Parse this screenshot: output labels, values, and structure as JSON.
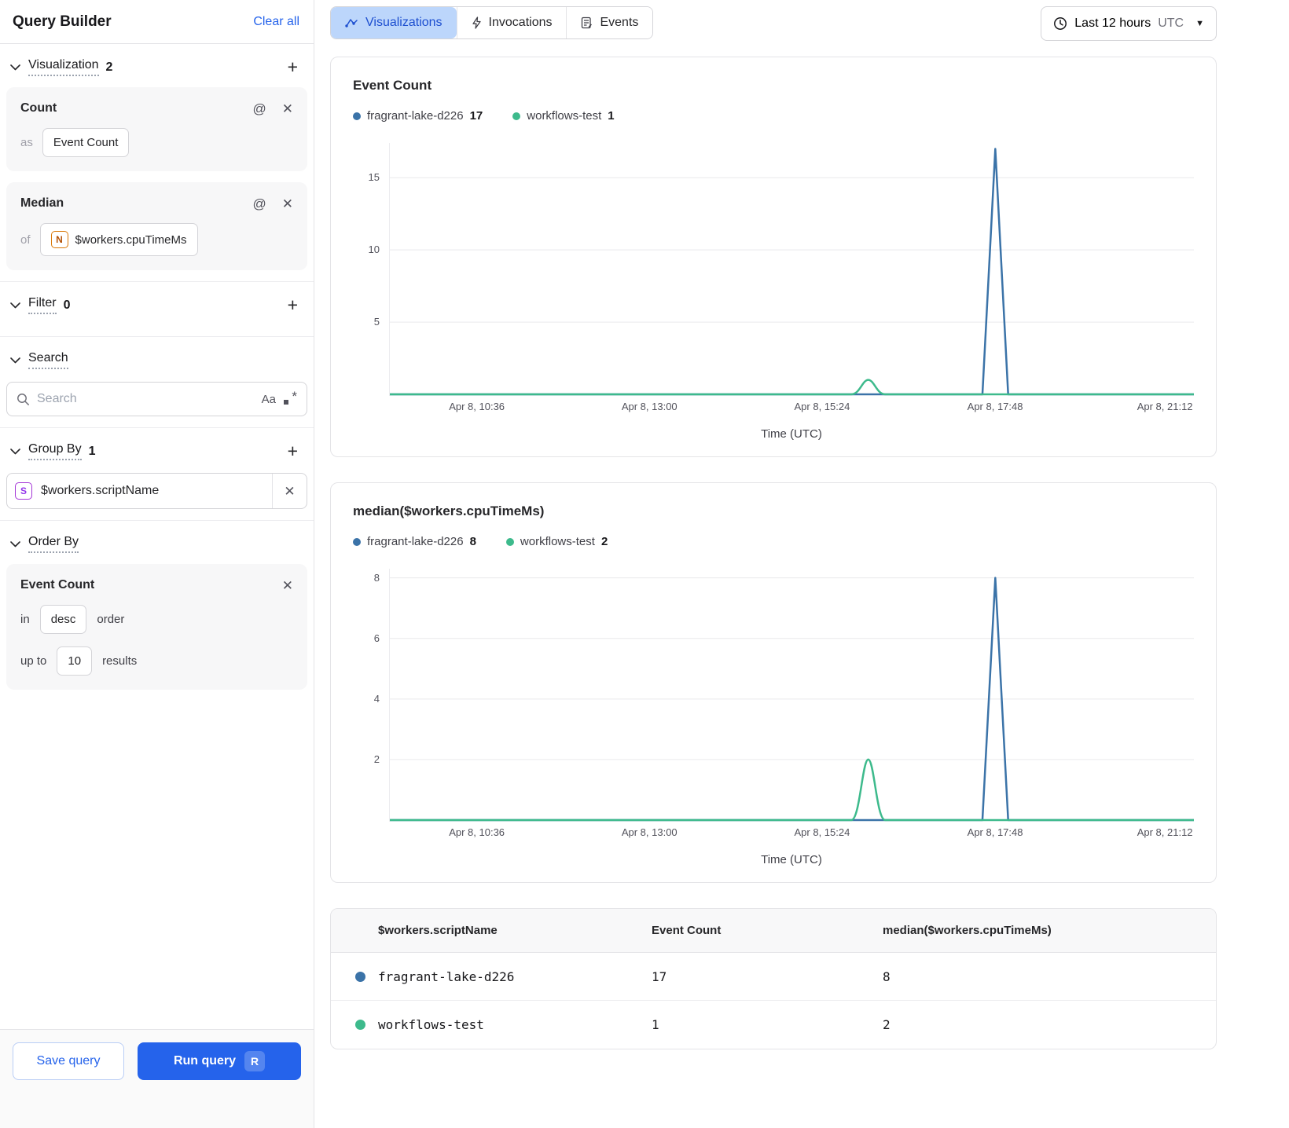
{
  "sidebar": {
    "title": "Query Builder",
    "clear_all": "Clear all",
    "visualization": {
      "label": "Visualization",
      "count": "2",
      "count_card": {
        "title": "Count",
        "prefix": "as",
        "value": "Event Count"
      },
      "median_card": {
        "title": "Median",
        "prefix": "of",
        "field_icon": "N",
        "value": "$workers.cpuTimeMs"
      }
    },
    "filter": {
      "label": "Filter",
      "count": "0"
    },
    "search": {
      "label": "Search",
      "placeholder": "Search",
      "match_case_label": "Aa"
    },
    "group_by": {
      "label": "Group By",
      "count": "1",
      "field_icon": "S",
      "value": "$workers.scriptName"
    },
    "order_by": {
      "label": "Order By",
      "field": "Event Count",
      "in_label": "in",
      "direction": "desc",
      "order_label": "order",
      "up_to_label": "up to",
      "limit": "10",
      "results_label": "results"
    },
    "footer": {
      "save_label": "Save query",
      "run_label": "Run query",
      "run_shortcut": "R"
    }
  },
  "topbar": {
    "tabs": [
      {
        "label": "Visualizations",
        "active": true
      },
      {
        "label": "Invocations",
        "active": false
      },
      {
        "label": "Events",
        "active": false
      }
    ],
    "time_range": {
      "label": "Last 12 hours",
      "timezone": "UTC"
    }
  },
  "colors": {
    "series_blue": "#3b73a8",
    "series_green": "#3dba8c",
    "accent_blue": "#2563eb"
  },
  "chart_data": [
    {
      "type": "line",
      "title": "Event Count",
      "xlabel": "Time (UTC)",
      "ylim": [
        0,
        17.3
      ],
      "y_ticks": [
        5,
        10,
        15
      ],
      "x_ticks": [
        {
          "label": "Apr 8, 10:36",
          "pos": 0.109
        },
        {
          "label": "Apr 8, 13:00",
          "pos": 0.3235
        },
        {
          "label": "Apr 8, 15:24",
          "pos": 0.538
        },
        {
          "label": "Apr 8, 17:48",
          "pos": 0.753
        },
        {
          "label": "Apr 8, 21:12",
          "pos": 0.964
        }
      ],
      "series": [
        {
          "name": "fragrant-lake-d226",
          "total": "17",
          "color": "#3b73a8",
          "points": [
            [
              0,
              0
            ],
            [
              0.737,
              0
            ],
            [
              0.753,
              17
            ],
            [
              0.769,
              0
            ],
            [
              1,
              0
            ]
          ]
        },
        {
          "name": "workflows-test",
          "total": "1",
          "color": "#3dba8c",
          "points": [
            [
              0,
              0
            ],
            [
              0.574,
              0
            ],
            [
              0.595,
              1
            ],
            [
              0.616,
              0
            ],
            [
              1,
              0
            ]
          ]
        }
      ]
    },
    {
      "type": "line",
      "title": "median($workers.cpuTimeMs)",
      "xlabel": "Time (UTC)",
      "ylim": [
        0,
        8.25
      ],
      "y_ticks": [
        2,
        4,
        6,
        8
      ],
      "x_ticks": [
        {
          "label": "Apr 8, 10:36",
          "pos": 0.109
        },
        {
          "label": "Apr 8, 13:00",
          "pos": 0.3235
        },
        {
          "label": "Apr 8, 15:24",
          "pos": 0.538
        },
        {
          "label": "Apr 8, 17:48",
          "pos": 0.753
        },
        {
          "label": "Apr 8, 21:12",
          "pos": 0.964
        }
      ],
      "series": [
        {
          "name": "fragrant-lake-d226",
          "total": "8",
          "color": "#3b73a8",
          "points": [
            [
              0,
              0
            ],
            [
              0.737,
              0
            ],
            [
              0.753,
              8
            ],
            [
              0.769,
              0
            ],
            [
              1,
              0
            ]
          ]
        },
        {
          "name": "workflows-test",
          "total": "2",
          "color": "#3dba8c",
          "points": [
            [
              0,
              0
            ],
            [
              0.574,
              0
            ],
            [
              0.595,
              2
            ],
            [
              0.616,
              0
            ],
            [
              1,
              0
            ]
          ]
        }
      ]
    }
  ],
  "table": {
    "columns": [
      "$workers.scriptName",
      "Event Count",
      "median($workers.cpuTimeMs)"
    ],
    "rows": [
      {
        "color": "#3b73a8",
        "script_name": "fragrant-lake-d226",
        "event_count": "17",
        "median": "8"
      },
      {
        "color": "#3dba8c",
        "script_name": "workflows-test",
        "event_count": "1",
        "median": "2"
      }
    ]
  }
}
